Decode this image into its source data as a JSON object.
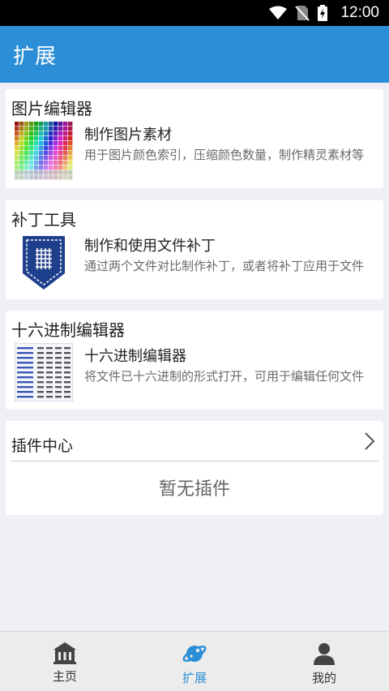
{
  "status_bar": {
    "time": "12:00"
  },
  "app_bar": {
    "title": "扩展"
  },
  "tools": [
    {
      "section_title": "图片编辑器",
      "title": "制作图片素材",
      "description": "用于图片颜色索引，压缩颜色数量，制作精灵素材等",
      "icon": "color-palette-icon"
    },
    {
      "section_title": "补丁工具",
      "title": "制作和使用文件补丁",
      "description": "通过两个文件对比制作补丁，或者将补丁应用于文件",
      "icon": "patch-badge-icon"
    },
    {
      "section_title": "十六进制编辑器",
      "title": "十六进制编辑器",
      "description": "将文件已十六进制的形式打开，可用于编辑任何文件",
      "icon": "hex-dump-icon"
    }
  ],
  "plugins": {
    "header": "插件中心",
    "empty_text": "暂无插件"
  },
  "bottom_nav": [
    {
      "label": "主页",
      "icon": "home-icon",
      "active": false
    },
    {
      "label": "扩展",
      "icon": "planet-icon",
      "active": true
    },
    {
      "label": "我的",
      "icon": "user-icon",
      "active": false
    }
  ],
  "colors": {
    "primary": "#2b8ed6",
    "background": "#eff0f5",
    "status_bar": "#000000"
  }
}
